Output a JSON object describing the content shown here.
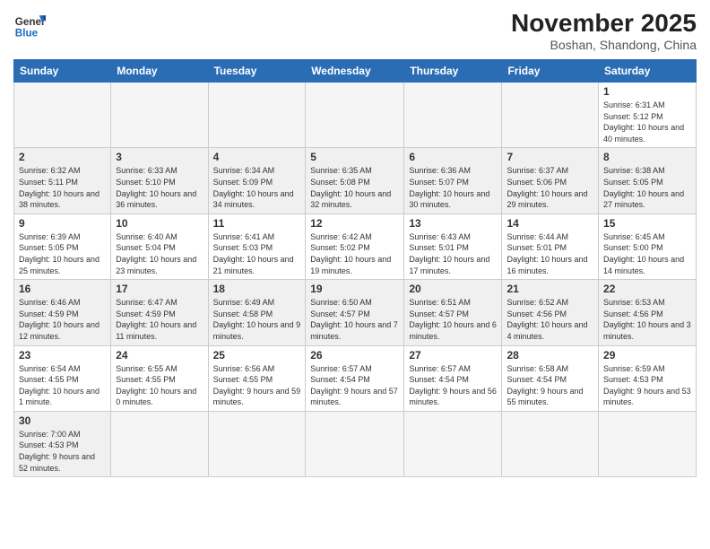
{
  "logo": {
    "text_general": "General",
    "text_blue": "Blue"
  },
  "title": {
    "month_year": "November 2025",
    "location": "Boshan, Shandong, China"
  },
  "weekdays": [
    "Sunday",
    "Monday",
    "Tuesday",
    "Wednesday",
    "Thursday",
    "Friday",
    "Saturday"
  ],
  "weeks": [
    [
      {
        "num": "",
        "info": ""
      },
      {
        "num": "",
        "info": ""
      },
      {
        "num": "",
        "info": ""
      },
      {
        "num": "",
        "info": ""
      },
      {
        "num": "",
        "info": ""
      },
      {
        "num": "",
        "info": ""
      },
      {
        "num": "1",
        "info": "Sunrise: 6:31 AM\nSunset: 5:12 PM\nDaylight: 10 hours and 40 minutes."
      }
    ],
    [
      {
        "num": "2",
        "info": "Sunrise: 6:32 AM\nSunset: 5:11 PM\nDaylight: 10 hours and 38 minutes."
      },
      {
        "num": "3",
        "info": "Sunrise: 6:33 AM\nSunset: 5:10 PM\nDaylight: 10 hours and 36 minutes."
      },
      {
        "num": "4",
        "info": "Sunrise: 6:34 AM\nSunset: 5:09 PM\nDaylight: 10 hours and 34 minutes."
      },
      {
        "num": "5",
        "info": "Sunrise: 6:35 AM\nSunset: 5:08 PM\nDaylight: 10 hours and 32 minutes."
      },
      {
        "num": "6",
        "info": "Sunrise: 6:36 AM\nSunset: 5:07 PM\nDaylight: 10 hours and 30 minutes."
      },
      {
        "num": "7",
        "info": "Sunrise: 6:37 AM\nSunset: 5:06 PM\nDaylight: 10 hours and 29 minutes."
      },
      {
        "num": "8",
        "info": "Sunrise: 6:38 AM\nSunset: 5:05 PM\nDaylight: 10 hours and 27 minutes."
      }
    ],
    [
      {
        "num": "9",
        "info": "Sunrise: 6:39 AM\nSunset: 5:05 PM\nDaylight: 10 hours and 25 minutes."
      },
      {
        "num": "10",
        "info": "Sunrise: 6:40 AM\nSunset: 5:04 PM\nDaylight: 10 hours and 23 minutes."
      },
      {
        "num": "11",
        "info": "Sunrise: 6:41 AM\nSunset: 5:03 PM\nDaylight: 10 hours and 21 minutes."
      },
      {
        "num": "12",
        "info": "Sunrise: 6:42 AM\nSunset: 5:02 PM\nDaylight: 10 hours and 19 minutes."
      },
      {
        "num": "13",
        "info": "Sunrise: 6:43 AM\nSunset: 5:01 PM\nDaylight: 10 hours and 17 minutes."
      },
      {
        "num": "14",
        "info": "Sunrise: 6:44 AM\nSunset: 5:01 PM\nDaylight: 10 hours and 16 minutes."
      },
      {
        "num": "15",
        "info": "Sunrise: 6:45 AM\nSunset: 5:00 PM\nDaylight: 10 hours and 14 minutes."
      }
    ],
    [
      {
        "num": "16",
        "info": "Sunrise: 6:46 AM\nSunset: 4:59 PM\nDaylight: 10 hours and 12 minutes."
      },
      {
        "num": "17",
        "info": "Sunrise: 6:47 AM\nSunset: 4:59 PM\nDaylight: 10 hours and 11 minutes."
      },
      {
        "num": "18",
        "info": "Sunrise: 6:49 AM\nSunset: 4:58 PM\nDaylight: 10 hours and 9 minutes."
      },
      {
        "num": "19",
        "info": "Sunrise: 6:50 AM\nSunset: 4:57 PM\nDaylight: 10 hours and 7 minutes."
      },
      {
        "num": "20",
        "info": "Sunrise: 6:51 AM\nSunset: 4:57 PM\nDaylight: 10 hours and 6 minutes."
      },
      {
        "num": "21",
        "info": "Sunrise: 6:52 AM\nSunset: 4:56 PM\nDaylight: 10 hours and 4 minutes."
      },
      {
        "num": "22",
        "info": "Sunrise: 6:53 AM\nSunset: 4:56 PM\nDaylight: 10 hours and 3 minutes."
      }
    ],
    [
      {
        "num": "23",
        "info": "Sunrise: 6:54 AM\nSunset: 4:55 PM\nDaylight: 10 hours and 1 minute."
      },
      {
        "num": "24",
        "info": "Sunrise: 6:55 AM\nSunset: 4:55 PM\nDaylight: 10 hours and 0 minutes."
      },
      {
        "num": "25",
        "info": "Sunrise: 6:56 AM\nSunset: 4:55 PM\nDaylight: 9 hours and 59 minutes."
      },
      {
        "num": "26",
        "info": "Sunrise: 6:57 AM\nSunset: 4:54 PM\nDaylight: 9 hours and 57 minutes."
      },
      {
        "num": "27",
        "info": "Sunrise: 6:57 AM\nSunset: 4:54 PM\nDaylight: 9 hours and 56 minutes."
      },
      {
        "num": "28",
        "info": "Sunrise: 6:58 AM\nSunset: 4:54 PM\nDaylight: 9 hours and 55 minutes."
      },
      {
        "num": "29",
        "info": "Sunrise: 6:59 AM\nSunset: 4:53 PM\nDaylight: 9 hours and 53 minutes."
      }
    ],
    [
      {
        "num": "30",
        "info": "Sunrise: 7:00 AM\nSunset: 4:53 PM\nDaylight: 9 hours and 52 minutes."
      },
      {
        "num": "",
        "info": ""
      },
      {
        "num": "",
        "info": ""
      },
      {
        "num": "",
        "info": ""
      },
      {
        "num": "",
        "info": ""
      },
      {
        "num": "",
        "info": ""
      },
      {
        "num": "",
        "info": ""
      }
    ]
  ]
}
